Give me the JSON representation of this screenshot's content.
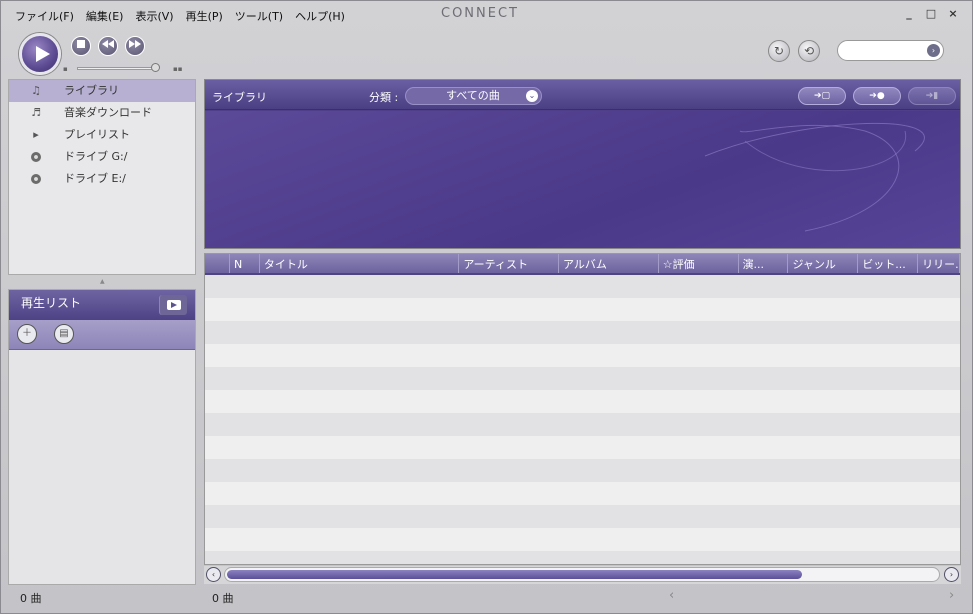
{
  "menubar": {
    "items": [
      "ファイル(F)",
      "編集(E)",
      "表示(V)",
      "再生(P)",
      "ツール(T)",
      "ヘルプ(H)"
    ]
  },
  "app": {
    "brand": "CONNECT"
  },
  "window_controls": {
    "minimize": "_",
    "maximize": "□",
    "close": "×"
  },
  "transport": {
    "play_icon": "play-icon",
    "stop_icon": "stop-icon",
    "prev_icon": "previous-icon",
    "next_icon": "next-icon",
    "repeat_icon": "repeat-icon",
    "shuffle_icon": "shuffle-icon",
    "volume_level": 0.95
  },
  "search": {
    "value": "",
    "placeholder": ""
  },
  "sidebar": {
    "items": [
      {
        "label": "ライブラリ",
        "icon": "music-note-icon",
        "active": true
      },
      {
        "label": "音楽ダウンロード",
        "icon": "music-download-icon",
        "active": false
      },
      {
        "label": "プレイリスト",
        "icon": "playlist-icon",
        "active": false
      },
      {
        "label": "ドライブ G:/",
        "icon": "disc-icon",
        "active": false
      },
      {
        "label": "ドライブ E:/",
        "icon": "disc-icon",
        "active": false
      }
    ]
  },
  "playlist_panel": {
    "title": "再生リスト",
    "count": "0 曲"
  },
  "library": {
    "title": "ライブラリ",
    "category_label": "分類 :",
    "category_value": "すべての曲",
    "actions": [
      "import-icon",
      "burn-cd-icon",
      "transfer-device-icon"
    ]
  },
  "table": {
    "columns": [
      "",
      "N",
      "タイトル",
      "アーティスト",
      "アルバム",
      "☆評価",
      "演...",
      "ジャンル",
      "ビット...",
      "リリー..."
    ],
    "rows": 13
  },
  "status": {
    "main_count": "0 曲"
  },
  "colors": {
    "accent": "#4f3f8a",
    "accent_light": "#b7b0d2"
  }
}
